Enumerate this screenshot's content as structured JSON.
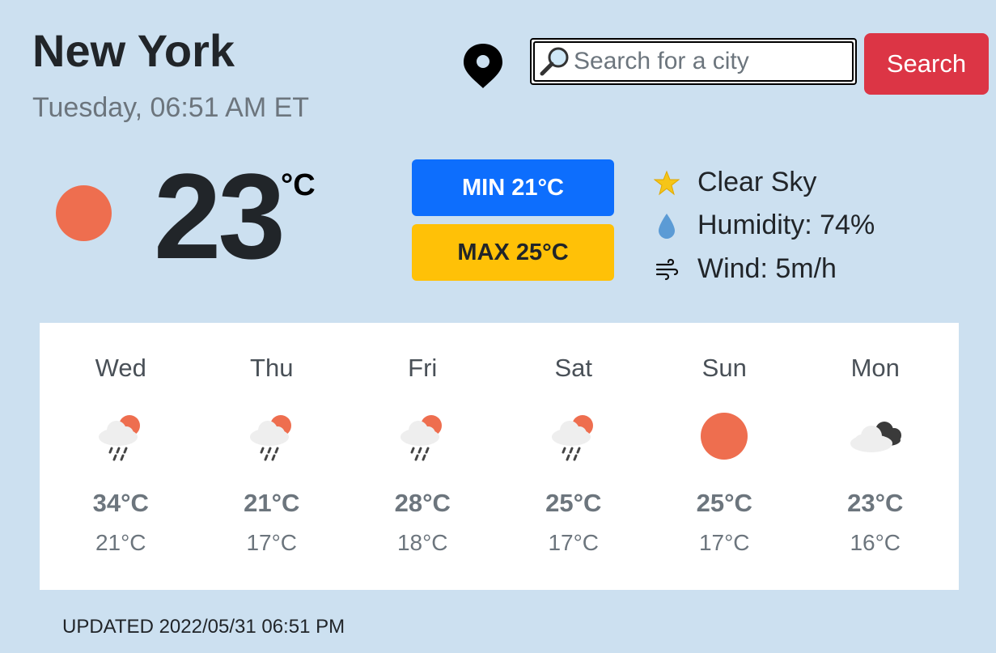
{
  "header": {
    "city": "New York",
    "datetime": "Tuesday, 06:51 AM ET"
  },
  "search": {
    "placeholder": "Search for a city",
    "value": "",
    "button_label": "Search"
  },
  "current": {
    "temperature": "23",
    "unit": "°C",
    "min_label": "MIN 21°C",
    "max_label": "MAX 25°C",
    "condition": "Clear Sky",
    "humidity": "Humidity: 74%",
    "wind": "Wind: 5m/h",
    "icon": "sun-icon"
  },
  "forecast": [
    {
      "day": "Wed",
      "max": "34°C",
      "min": "21°C",
      "icon": "rain-sun-icon"
    },
    {
      "day": "Thu",
      "max": "21°C",
      "min": "17°C",
      "icon": "rain-sun-icon"
    },
    {
      "day": "Fri",
      "max": "28°C",
      "min": "18°C",
      "icon": "rain-sun-icon"
    },
    {
      "day": "Sat",
      "max": "25°C",
      "min": "17°C",
      "icon": "rain-sun-icon"
    },
    {
      "day": "Sun",
      "max": "25°C",
      "min": "17°C",
      "icon": "sun-icon"
    },
    {
      "day": "Mon",
      "max": "23°C",
      "min": "16°C",
      "icon": "cloudy-icon"
    }
  ],
  "footer": {
    "updated": "UPDATED 2022/05/31 06:51 PM"
  },
  "colors": {
    "background": "#cce0f0",
    "search_button": "#dc3545",
    "min_badge": "#0d6efd",
    "max_badge": "#ffc107",
    "sun": "#ee6e4f"
  }
}
